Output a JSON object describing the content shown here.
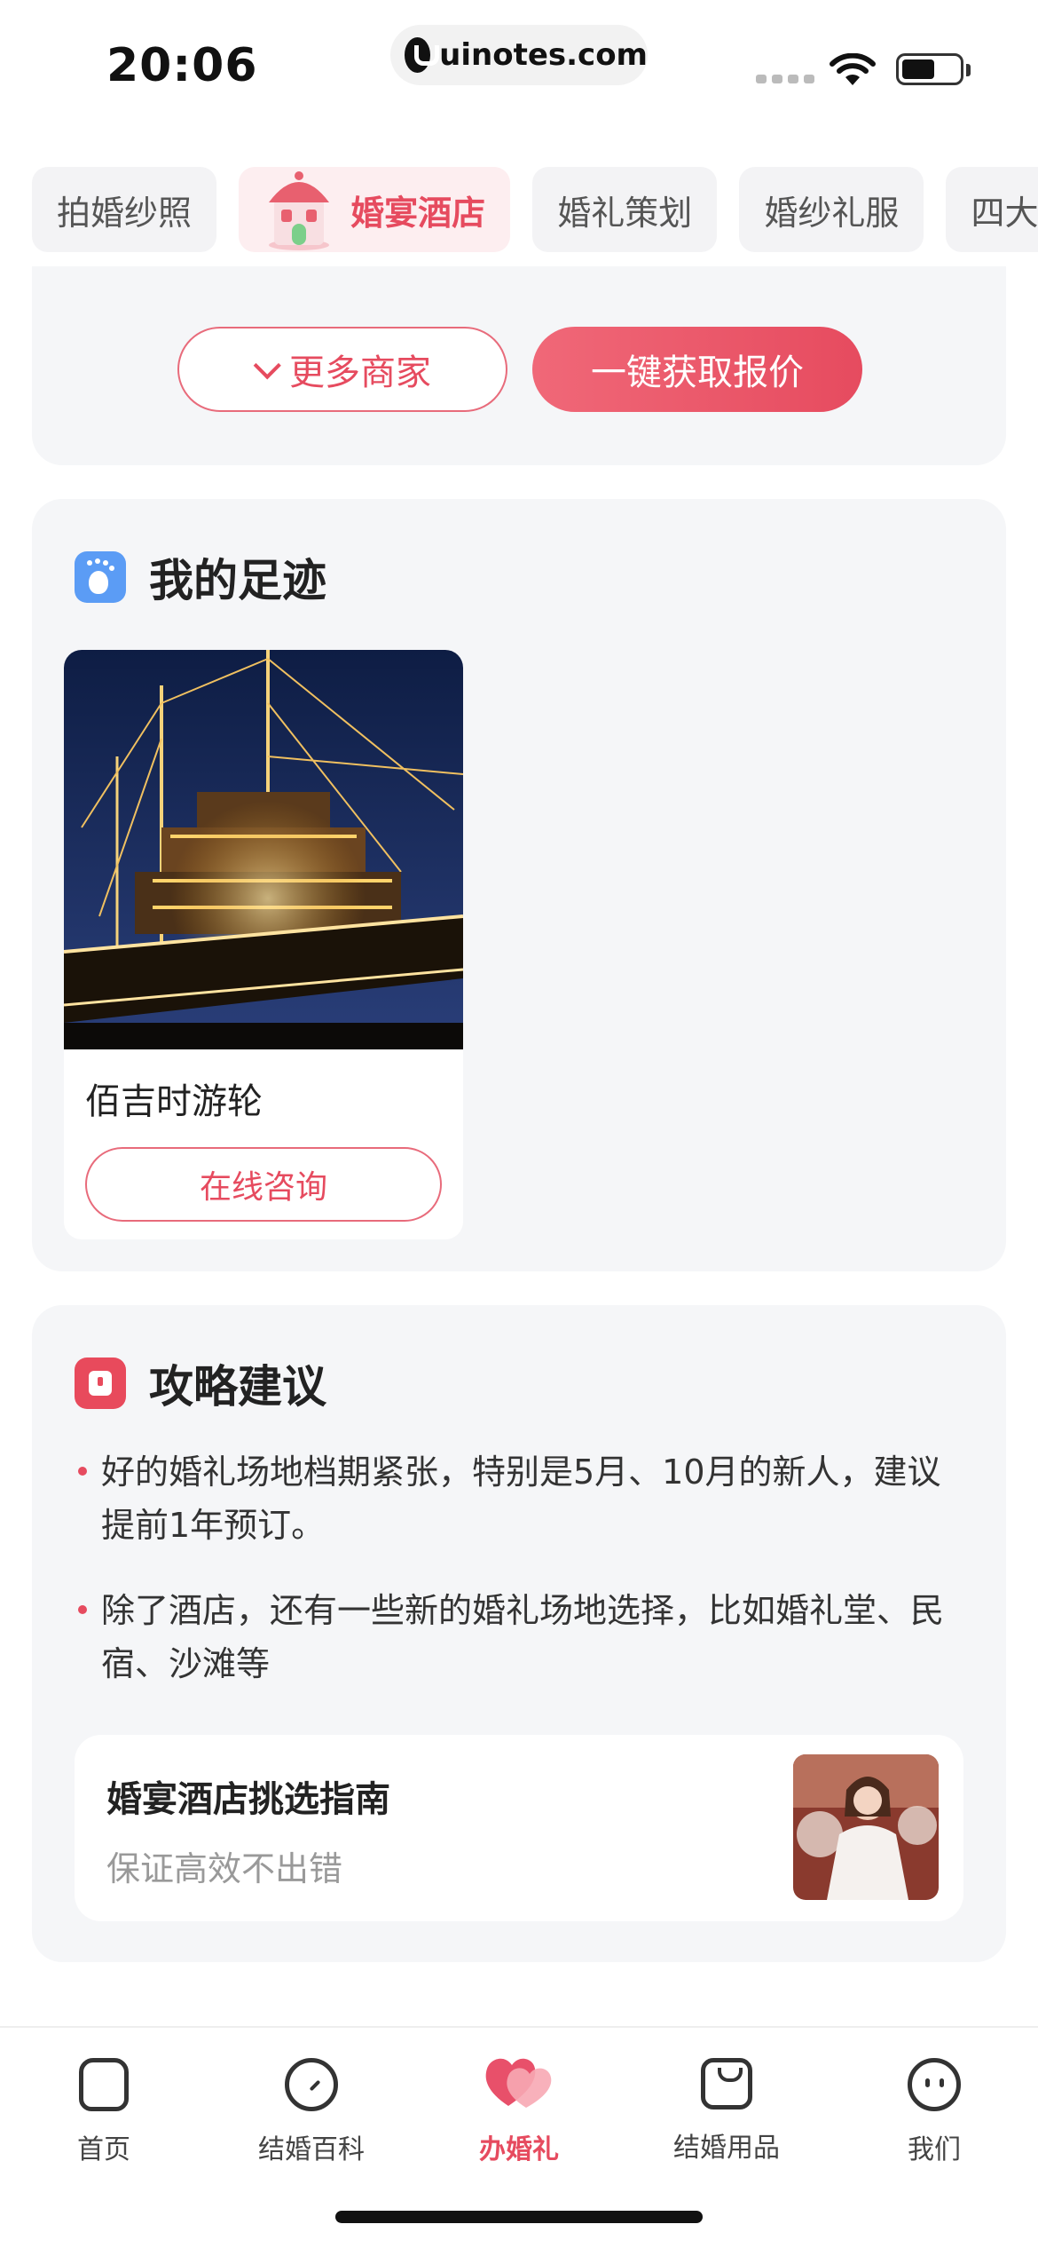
{
  "status_bar": {
    "time": "20:06",
    "url": "uinotes.com"
  },
  "tabs": [
    {
      "label": "拍婚纱照",
      "active": false
    },
    {
      "label": "婚宴酒店",
      "active": true
    },
    {
      "label": "婚礼策划",
      "active": false
    },
    {
      "label": "婚纱礼服",
      "active": false
    },
    {
      "label": "四大",
      "active": false
    }
  ],
  "actions": {
    "more_label": "更多商家",
    "quote_label": "一键获取报价"
  },
  "footprint": {
    "title": "我的足迹",
    "venue_name": "佰吉时游轮",
    "consult_label": "在线咨询"
  },
  "tips": {
    "title": "攻略建议",
    "items": [
      "好的婚礼场地档期紧张，特别是5月、10月的新人，建议提前1年预订。",
      "除了酒店，还有一些新的婚礼场地选择，比如婚礼堂、民宿、沙滩等"
    ],
    "guide_title": "婚宴酒店挑选指南",
    "guide_subtitle": "保证高效不出错"
  },
  "bottom_nav": [
    {
      "label": "首页",
      "icon": "home-icon"
    },
    {
      "label": "结婚百科",
      "icon": "compass-icon"
    },
    {
      "label": "办婚礼",
      "icon": "heart-icon",
      "active": true
    },
    {
      "label": "结婚用品",
      "icon": "bag-icon"
    },
    {
      "label": "我们",
      "icon": "face-icon"
    }
  ],
  "colors": {
    "accent": "#e64b5f",
    "card_bg": "#f5f6f8",
    "footprint_icon": "#5b9cf5"
  }
}
